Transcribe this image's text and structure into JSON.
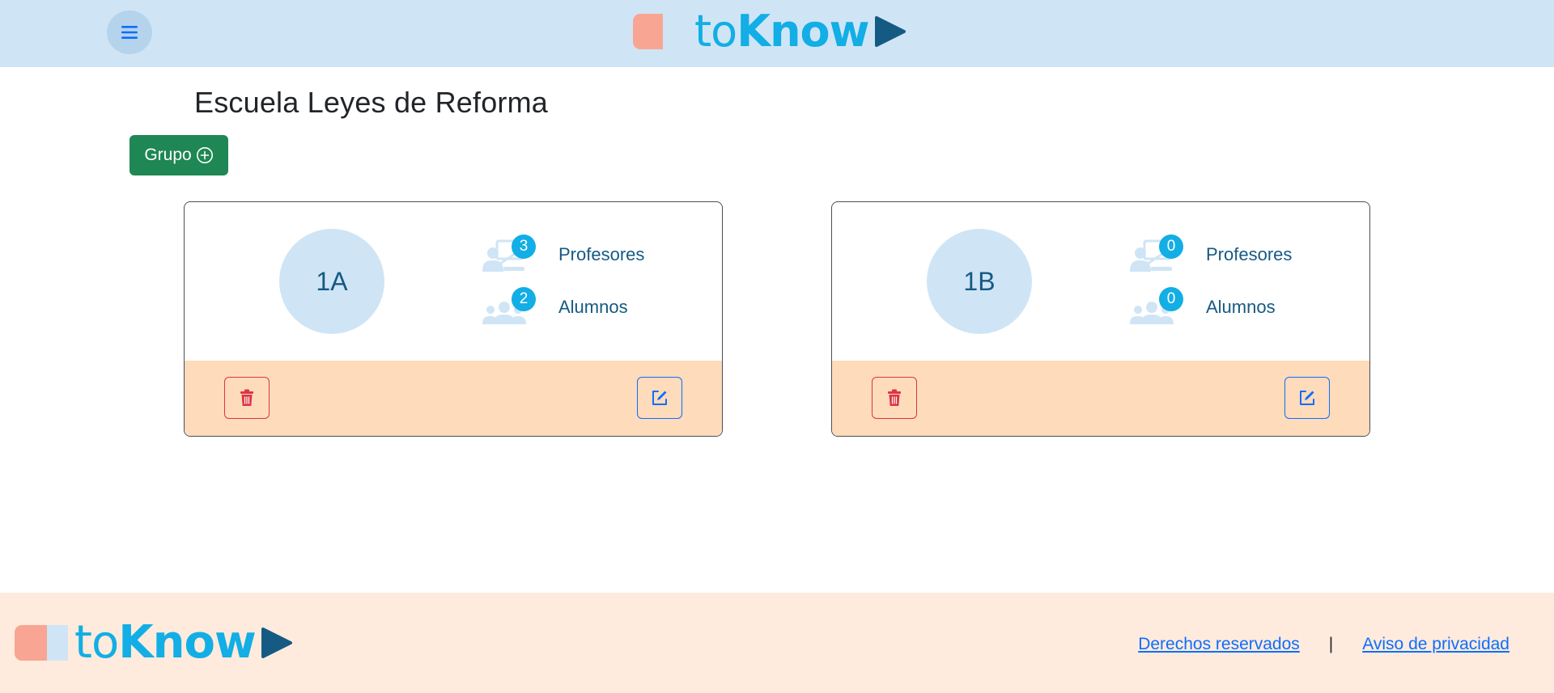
{
  "header": {
    "menu_icon": "hamburger-icon",
    "logo": {
      "text_light": "to",
      "text_bold": "Know"
    }
  },
  "page": {
    "title": "Escuela Leyes de Reforma",
    "add_group_label": "Grupo",
    "add_group_icon": "plus-circle-icon"
  },
  "groups": [
    {
      "name": "1A",
      "teachers_count": "3",
      "teachers_label": "Profesores",
      "students_count": "2",
      "students_label": "Alumnos"
    },
    {
      "name": "1B",
      "teachers_count": "0",
      "teachers_label": "Profesores",
      "students_count": "0",
      "students_label": "Alumnos"
    }
  ],
  "footer": {
    "logo": {
      "text_light": "to",
      "text_bold": "Know"
    },
    "link_rights": "Derechos reservados",
    "separator": "|",
    "link_privacy": "Aviso de privacidad"
  },
  "colors": {
    "header_bg": "#cfe5f6",
    "footer_bg": "#feebdd",
    "card_bottom_bg": "#fedbbb",
    "brand_blue": "#12aee5",
    "brand_dark": "#155a83",
    "brand_salmon": "#f8a693",
    "add_button": "#1e8753",
    "danger": "#dc3545",
    "primary": "#0d6efd"
  }
}
